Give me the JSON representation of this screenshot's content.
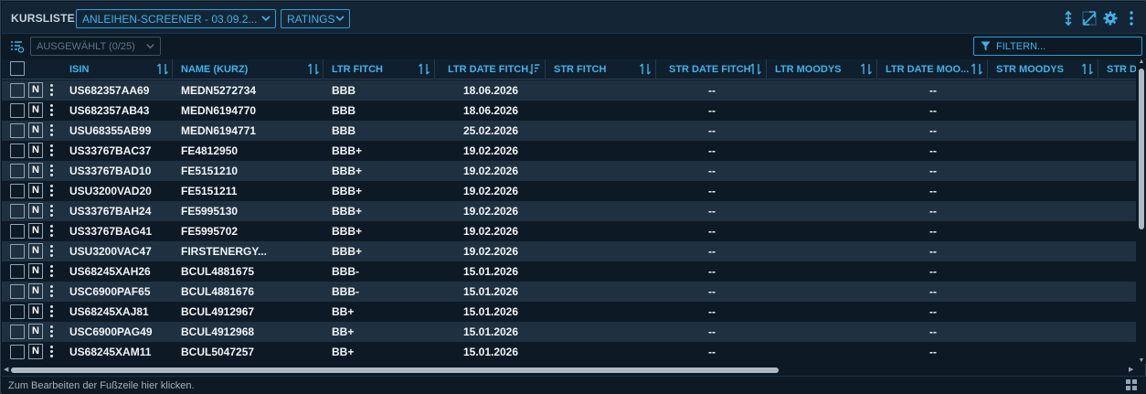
{
  "header": {
    "title": "KURSLISTE",
    "screener_dropdown": "ANLEIHEN-SCREENER - 03.09.2...",
    "view_dropdown": "RATINGS",
    "icons": [
      "pin-icon",
      "expand-icon",
      "gear-icon",
      "more-vertical-icon"
    ]
  },
  "toolbar": {
    "selected_label": "AUSGEWÄHLT (0/25)",
    "filter_placeholder": "FILTERN..."
  },
  "columns": [
    {
      "key": "isin",
      "label": "ISIN"
    },
    {
      "key": "name",
      "label": "NAME (KURZ)"
    },
    {
      "key": "ltr_fitch",
      "label": "LTR FITCH"
    },
    {
      "key": "ltr_date_fitch",
      "label": "LTR DATE FITCH"
    },
    {
      "key": "str_fitch",
      "label": "STR FITCH"
    },
    {
      "key": "str_date_fitch",
      "label": "STR DATE FITCH"
    },
    {
      "key": "ltr_moodys",
      "label": "LTR MOODYS"
    },
    {
      "key": "ltr_date_moodys",
      "label": "LTR DATE MOO..."
    },
    {
      "key": "str_moodys",
      "label": "STR MOODYS"
    },
    {
      "key": "str_date",
      "label": "STR DA"
    }
  ],
  "rows": [
    {
      "n": "N",
      "isin": "US682357AA69",
      "name": "MEDN5272734",
      "ltr_fitch": "BBB",
      "ltr_date_fitch": "18.06.2026",
      "str_date_fitch": "--",
      "ltr_date_moodys": "--"
    },
    {
      "n": "N",
      "isin": "US682357AB43",
      "name": "MEDN6194770",
      "ltr_fitch": "BBB",
      "ltr_date_fitch": "18.06.2026",
      "str_date_fitch": "--",
      "ltr_date_moodys": "--"
    },
    {
      "n": "N",
      "isin": "USU68355AB99",
      "name": "MEDN6194771",
      "ltr_fitch": "BBB",
      "ltr_date_fitch": "25.02.2026",
      "str_date_fitch": "--",
      "ltr_date_moodys": "--"
    },
    {
      "n": "N",
      "isin": "US33767BAC37",
      "name": "FE4812950",
      "ltr_fitch": "BBB+",
      "ltr_date_fitch": "19.02.2026",
      "str_date_fitch": "--",
      "ltr_date_moodys": "--"
    },
    {
      "n": "N",
      "isin": "US33767BAD10",
      "name": "FE5151210",
      "ltr_fitch": "BBB+",
      "ltr_date_fitch": "19.02.2026",
      "str_date_fitch": "--",
      "ltr_date_moodys": "--"
    },
    {
      "n": "N",
      "isin": "USU3200VAD20",
      "name": "FE5151211",
      "ltr_fitch": "BBB+",
      "ltr_date_fitch": "19.02.2026",
      "str_date_fitch": "--",
      "ltr_date_moodys": "--"
    },
    {
      "n": "N",
      "isin": "US33767BAH24",
      "name": "FE5995130",
      "ltr_fitch": "BBB+",
      "ltr_date_fitch": "19.02.2026",
      "str_date_fitch": "--",
      "ltr_date_moodys": "--"
    },
    {
      "n": "N",
      "isin": "US33767BAG41",
      "name": "FE5995702",
      "ltr_fitch": "BBB+",
      "ltr_date_fitch": "19.02.2026",
      "str_date_fitch": "--",
      "ltr_date_moodys": "--"
    },
    {
      "n": "N",
      "isin": "USU3200VAC47",
      "name": "FIRSTENERGY...",
      "ltr_fitch": "BBB+",
      "ltr_date_fitch": "19.02.2026",
      "str_date_fitch": "--",
      "ltr_date_moodys": "--"
    },
    {
      "n": "N",
      "isin": "US68245XAH26",
      "name": "BCUL4881675",
      "ltr_fitch": "BBB-",
      "ltr_date_fitch": "15.01.2026",
      "str_date_fitch": "--",
      "ltr_date_moodys": "--"
    },
    {
      "n": "N",
      "isin": "USC6900PAF65",
      "name": "BCUL4881676",
      "ltr_fitch": "BBB-",
      "ltr_date_fitch": "15.01.2026",
      "str_date_fitch": "--",
      "ltr_date_moodys": "--"
    },
    {
      "n": "N",
      "isin": "US68245XAJ81",
      "name": "BCUL4912967",
      "ltr_fitch": "BB+",
      "ltr_date_fitch": "15.01.2026",
      "str_date_fitch": "--",
      "ltr_date_moodys": "--"
    },
    {
      "n": "N",
      "isin": "USC6900PAG49",
      "name": "BCUL4912968",
      "ltr_fitch": "BB+",
      "ltr_date_fitch": "15.01.2026",
      "str_date_fitch": "--",
      "ltr_date_moodys": "--"
    },
    {
      "n": "N",
      "isin": "US68245XAM11",
      "name": "BCUL5047257",
      "ltr_fitch": "BB+",
      "ltr_date_fitch": "15.01.2026",
      "str_date_fitch": "--",
      "ltr_date_moodys": "--"
    }
  ],
  "footer": {
    "text": "Zum Bearbeiten der Fußzeile hier klicken."
  },
  "colors": {
    "accent": "#3fb3ec",
    "row_alt": "#1f3140",
    "background": "#0d1a26"
  }
}
